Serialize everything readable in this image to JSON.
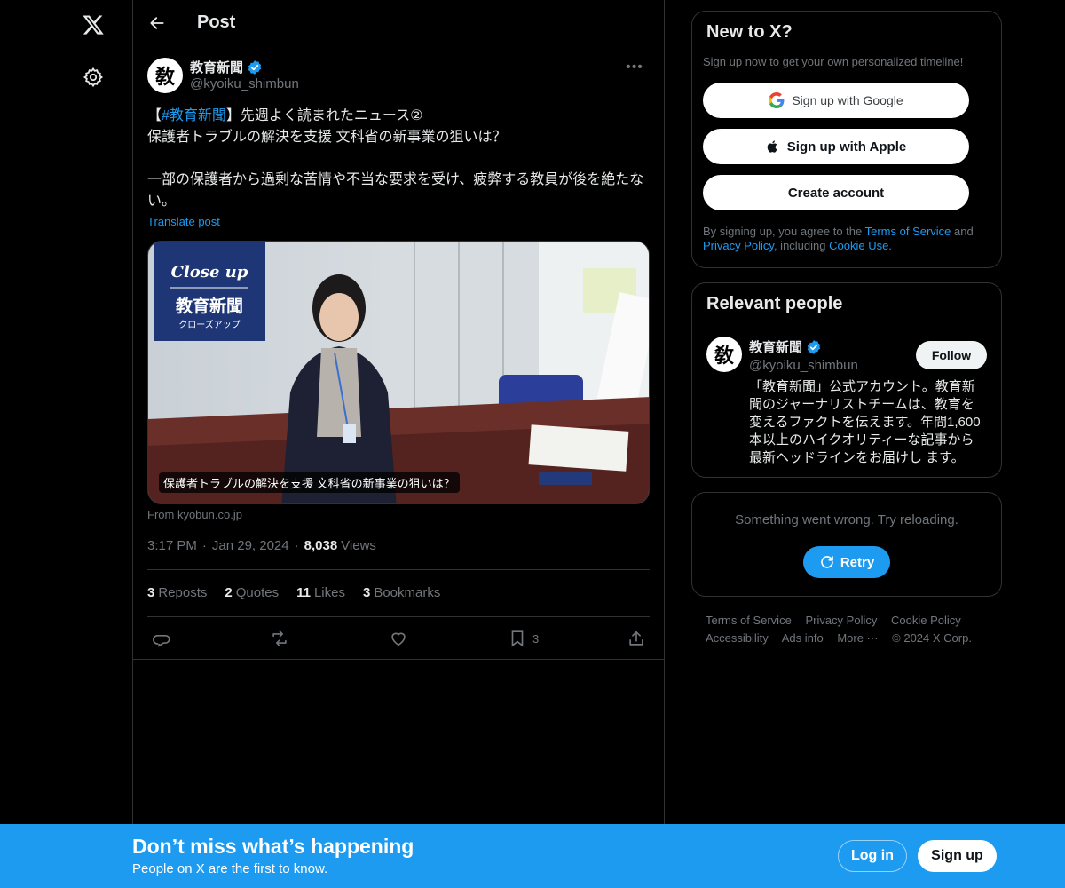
{
  "nav": {
    "logo_icon": "x-logo-icon",
    "settings_icon": "gear-icon"
  },
  "header": {
    "title": "Post"
  },
  "post": {
    "author_name": "教育新聞",
    "author_handle": "@kyoiku_shimbun",
    "avatar_text": "敎",
    "more_label": "•••",
    "text_prefix": "【",
    "hashtag": "#教育新聞",
    "text_line1_rest": "】先週よく読まれたニュース②",
    "text_line2": "保護者トラブルの解決を支援 文科省の新事業の狙いは？",
    "text_line3": "一部の保護者から過剰な苦情や不当な要求を受け、疲弊する教員が後を絶たない。",
    "translate": "Translate post",
    "media_caption": "保護者トラブルの解決を支援 文科省の新事業の狙いは？",
    "media_badge_title": "Close up",
    "media_badge_name": "教育新聞",
    "media_badge_sub": "クローズアップ",
    "media_source": "From kyobun.co.jp",
    "time": "3:17 PM",
    "date": "Jan 29, 2024",
    "views_count": "8,038",
    "views_label": "Views",
    "stats": {
      "reposts_count": "3",
      "reposts_label": "Reposts",
      "quotes_count": "2",
      "quotes_label": "Quotes",
      "likes_count": "11",
      "likes_label": "Likes",
      "bookmarks_count": "3",
      "bookmarks_label": "Bookmarks"
    },
    "bookmark_action_count": "3"
  },
  "signup_card": {
    "title": "New to X?",
    "subtitle": "Sign up now to get your own personalized timeline!",
    "google": "Sign up with Google",
    "apple": "Sign up with Apple",
    "create": "Create account",
    "legal_prefix": "By signing up, you agree to the ",
    "terms": "Terms of Service",
    "and": " and ",
    "privacy": "Privacy Policy",
    "including": ", including ",
    "cookie": "Cookie Use."
  },
  "people_card": {
    "title": "Relevant people",
    "name": "教育新聞",
    "handle": "@kyoiku_shimbun",
    "avatar_text": "敎",
    "follow": "Follow",
    "bio": "「教育新聞」公式アカウント。教育新聞のジャーナリストチームは、教育を変えるファクトを伝えます。年間1,600本以上のハイクオリティーな記事から最新ヘッドラインをお届けし ます。"
  },
  "error_card": {
    "message": "Something went wrong. Try reloading.",
    "retry": "Retry"
  },
  "footer": {
    "terms": "Terms of Service",
    "privacy": "Privacy Policy",
    "cookie": "Cookie Policy",
    "accessibility": "Accessibility",
    "ads": "Ads info",
    "more": "More ···",
    "copyright": "© 2024 X Corp."
  },
  "banner": {
    "title": "Don’t miss what’s happening",
    "subtitle": "People on X are the first to know.",
    "login": "Log in",
    "signup": "Sign up"
  },
  "colors": {
    "accent": "#1d9bf0",
    "background": "#000000",
    "border": "#2f3336",
    "muted": "#71767b"
  }
}
